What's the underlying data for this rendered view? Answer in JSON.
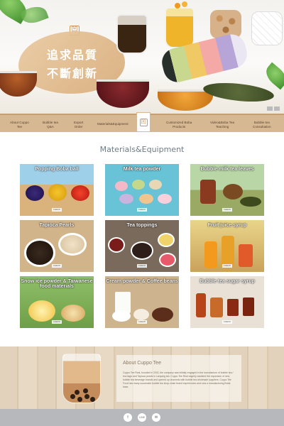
{
  "hero": {
    "slogan_line1": "追求品質",
    "slogan_line2": "不斷創新",
    "logo_glyph": "凹",
    "carousel_indicator_count": 2
  },
  "nav": {
    "left_items": [
      {
        "line1": "About Cuppo",
        "line2": "Tee"
      },
      {
        "line1": "Bubble tea",
        "line2": "Q&A"
      },
      {
        "line1": "Export",
        "line2": "Order"
      },
      {
        "line1": "Materials&Equipment",
        "line2": ""
      }
    ],
    "right_items": [
      {
        "line1": "Customized Boba",
        "line2": "Products"
      },
      {
        "line1": "Video&Boba Tea",
        "line2": "Teaching"
      },
      {
        "line1": "Bubble tea",
        "line2": "Consultation"
      }
    ],
    "logo_glyph": "凹"
  },
  "section": {
    "title": "Materials&Equipment"
  },
  "cards": [
    {
      "label": "Popping Boba ball",
      "button": "CHECK"
    },
    {
      "label": "Milk tea powder",
      "button": "CHECK"
    },
    {
      "label": "Bubble milk tea leaves",
      "button": "CHECK"
    },
    {
      "label": "Tapioca Pearls",
      "button": "CHECK"
    },
    {
      "label": "Tea toppings",
      "button": "CHECK"
    },
    {
      "label": "Fruit juice syrup",
      "button": "CHECK"
    },
    {
      "label": "Snow ice powder & Taiwanese food materials",
      "button": "CHECK"
    },
    {
      "label": "Cream powder & Coffee beans",
      "button": "CHECK"
    },
    {
      "label": "Bubble tea sugar syrup",
      "button": "CHECK"
    }
  ],
  "about": {
    "title": "About Cuppo Tee",
    "text": "Cuppo Tee Real, founded in 2002, the company was initially engaged in the manufacture of bubble tea / tea bags and Tapioca pearls in Lanyang tea. Cuppo Tee Real eagerly assisted the expansion of new bubble tea beverage brands and opened up channels with bubble tea wholesale suppliers. Cuppo Tee Food has many successful bubble tea shop chain brand experiences and runs a manufacturing Boba base."
  },
  "social": {
    "items": [
      "f",
      "LINE",
      "✉"
    ]
  },
  "colors": {
    "nav_bg": "#d6b893",
    "accent": "#c99a63",
    "footer_bar": "#b7b8bb",
    "section_title": "#6f7b85"
  }
}
